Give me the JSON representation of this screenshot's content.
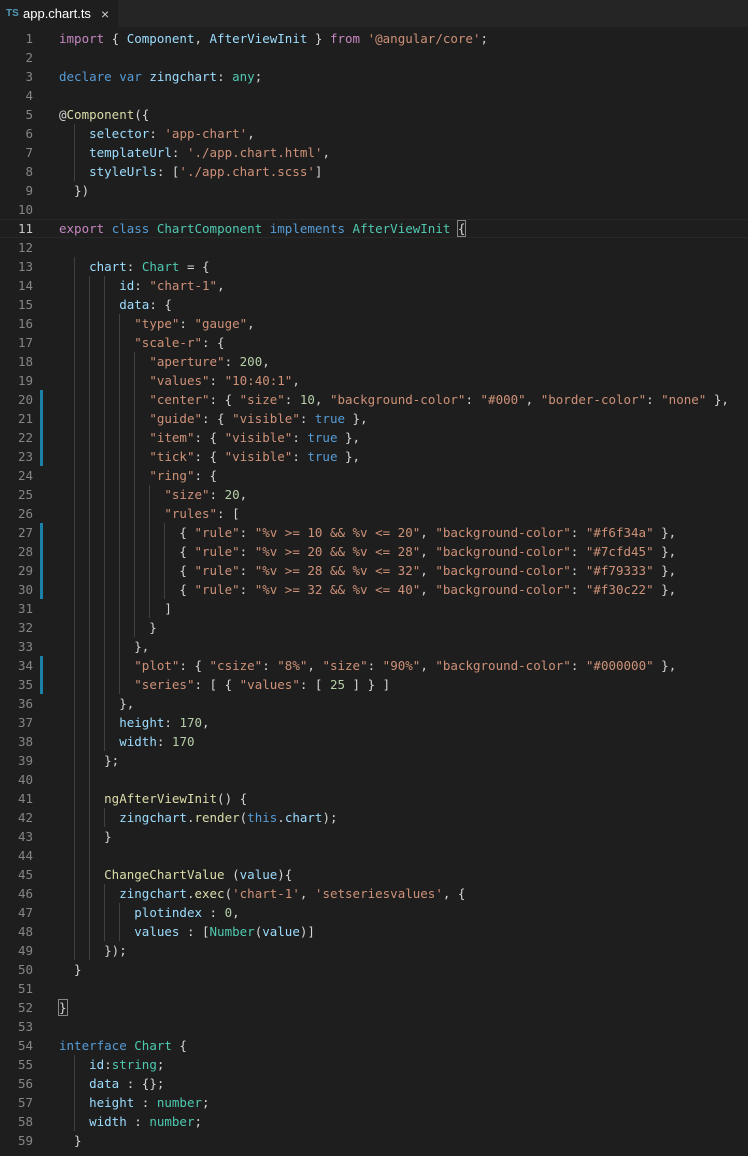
{
  "tab": {
    "icon_text": "TS",
    "filename": "app.chart.ts",
    "close_glyph": "×"
  },
  "editor": {
    "current_line": 11,
    "modified_lines": [
      20,
      21,
      22,
      23,
      27,
      28,
      29,
      30,
      34,
      35
    ],
    "lines": [
      {
        "n": "1",
        "t": [
          [
            "import",
            "ctl"
          ],
          [
            " { "
          ],
          [
            "Component",
            "prop"
          ],
          [
            ", "
          ],
          [
            "AfterViewInit",
            "prop"
          ],
          [
            " } "
          ],
          [
            "from",
            "ctl"
          ],
          [
            " "
          ],
          [
            "'@angular/core'",
            "str"
          ],
          [
            ";"
          ]
        ]
      },
      {
        "n": "2",
        "t": []
      },
      {
        "n": "3",
        "t": [
          [
            "declare",
            "kw"
          ],
          [
            " "
          ],
          [
            "var",
            "kw"
          ],
          [
            " "
          ],
          [
            "zingchart",
            "prop"
          ],
          [
            ": "
          ],
          [
            "any",
            "ty"
          ],
          [
            ";"
          ]
        ]
      },
      {
        "n": "4",
        "t": []
      },
      {
        "n": "5",
        "t": [
          [
            "@"
          ],
          [
            "Component",
            "fn"
          ],
          [
            "({"
          ]
        ]
      },
      {
        "n": "6",
        "t": [
          [
            "    "
          ],
          [
            "selector",
            "prop"
          ],
          [
            ": "
          ],
          [
            "'app-chart'",
            "str"
          ],
          [
            ","
          ]
        ]
      },
      {
        "n": "7",
        "t": [
          [
            "    "
          ],
          [
            "templateUrl",
            "prop"
          ],
          [
            ": "
          ],
          [
            "'./app.chart.html'",
            "str"
          ],
          [
            ","
          ]
        ]
      },
      {
        "n": "8",
        "t": [
          [
            "    "
          ],
          [
            "styleUrls",
            "prop"
          ],
          [
            ": ["
          ],
          [
            "'./app.chart.scss'",
            "str"
          ],
          [
            "]"
          ]
        ]
      },
      {
        "n": "9",
        "t": [
          [
            "  })"
          ]
        ]
      },
      {
        "n": "10",
        "t": []
      },
      {
        "n": "11",
        "t": [
          [
            "export",
            "ctl"
          ],
          [
            " "
          ],
          [
            "class",
            "kw"
          ],
          [
            " "
          ],
          [
            "ChartComponent",
            "ty"
          ],
          [
            " "
          ],
          [
            "implements",
            "kw"
          ],
          [
            " "
          ],
          [
            "AfterViewInit",
            "ty"
          ],
          [
            " "
          ],
          [
            "{",
            "br"
          ]
        ]
      },
      {
        "n": "12",
        "t": []
      },
      {
        "n": "13",
        "t": [
          [
            "    "
          ],
          [
            "chart",
            "prop"
          ],
          [
            ": "
          ],
          [
            "Chart",
            "ty"
          ],
          [
            " = {"
          ]
        ]
      },
      {
        "n": "14",
        "t": [
          [
            "        "
          ],
          [
            "id",
            "prop"
          ],
          [
            ": "
          ],
          [
            "\"chart-1\"",
            "str"
          ],
          [
            ","
          ]
        ]
      },
      {
        "n": "15",
        "t": [
          [
            "        "
          ],
          [
            "data",
            "prop"
          ],
          [
            ": {"
          ]
        ]
      },
      {
        "n": "16",
        "t": [
          [
            "          "
          ],
          [
            "\"type\"",
            "str"
          ],
          [
            ": "
          ],
          [
            "\"gauge\"",
            "str"
          ],
          [
            ","
          ]
        ]
      },
      {
        "n": "17",
        "t": [
          [
            "          "
          ],
          [
            "\"scale-r\"",
            "str"
          ],
          [
            ": {"
          ]
        ]
      },
      {
        "n": "18",
        "t": [
          [
            "            "
          ],
          [
            "\"aperture\"",
            "str"
          ],
          [
            ": "
          ],
          [
            "200",
            "num"
          ],
          [
            ","
          ]
        ]
      },
      {
        "n": "19",
        "t": [
          [
            "            "
          ],
          [
            "\"values\"",
            "str"
          ],
          [
            ": "
          ],
          [
            "\"10:40:1\"",
            "str"
          ],
          [
            ","
          ]
        ]
      },
      {
        "n": "20",
        "t": [
          [
            "            "
          ],
          [
            "\"center\"",
            "str"
          ],
          [
            ": { "
          ],
          [
            "\"size\"",
            "str"
          ],
          [
            ": "
          ],
          [
            "10",
            "num"
          ],
          [
            ", "
          ],
          [
            "\"background-color\"",
            "str"
          ],
          [
            ": "
          ],
          [
            "\"#000\"",
            "str"
          ],
          [
            ", "
          ],
          [
            "\"border-color\"",
            "str"
          ],
          [
            ": "
          ],
          [
            "\"none\"",
            "str"
          ],
          [
            " },"
          ]
        ]
      },
      {
        "n": "21",
        "t": [
          [
            "            "
          ],
          [
            "\"guide\"",
            "str"
          ],
          [
            ": { "
          ],
          [
            "\"visible\"",
            "str"
          ],
          [
            ": "
          ],
          [
            "true",
            "kw"
          ],
          [
            " },"
          ]
        ]
      },
      {
        "n": "22",
        "t": [
          [
            "            "
          ],
          [
            "\"item\"",
            "str"
          ],
          [
            ": { "
          ],
          [
            "\"visible\"",
            "str"
          ],
          [
            ": "
          ],
          [
            "true",
            "kw"
          ],
          [
            " },"
          ]
        ]
      },
      {
        "n": "23",
        "t": [
          [
            "            "
          ],
          [
            "\"tick\"",
            "str"
          ],
          [
            ": { "
          ],
          [
            "\"visible\"",
            "str"
          ],
          [
            ": "
          ],
          [
            "true",
            "kw"
          ],
          [
            " },"
          ]
        ]
      },
      {
        "n": "24",
        "t": [
          [
            "            "
          ],
          [
            "\"ring\"",
            "str"
          ],
          [
            ": {"
          ]
        ]
      },
      {
        "n": "25",
        "t": [
          [
            "              "
          ],
          [
            "\"size\"",
            "str"
          ],
          [
            ": "
          ],
          [
            "20",
            "num"
          ],
          [
            ","
          ]
        ]
      },
      {
        "n": "26",
        "t": [
          [
            "              "
          ],
          [
            "\"rules\"",
            "str"
          ],
          [
            ": ["
          ]
        ]
      },
      {
        "n": "27",
        "t": [
          [
            "                { "
          ],
          [
            "\"rule\"",
            "str"
          ],
          [
            ": "
          ],
          [
            "\"%v >= 10 && %v <= 20\"",
            "str"
          ],
          [
            ", "
          ],
          [
            "\"background-color\"",
            "str"
          ],
          [
            ": "
          ],
          [
            "\"#f6f34a\"",
            "str"
          ],
          [
            " },"
          ]
        ]
      },
      {
        "n": "28",
        "t": [
          [
            "                { "
          ],
          [
            "\"rule\"",
            "str"
          ],
          [
            ": "
          ],
          [
            "\"%v >= 20 && %v <= 28\"",
            "str"
          ],
          [
            ", "
          ],
          [
            "\"background-color\"",
            "str"
          ],
          [
            ": "
          ],
          [
            "\"#7cfd45\"",
            "str"
          ],
          [
            " },"
          ]
        ]
      },
      {
        "n": "29",
        "t": [
          [
            "                { "
          ],
          [
            "\"rule\"",
            "str"
          ],
          [
            ": "
          ],
          [
            "\"%v >= 28 && %v <= 32\"",
            "str"
          ],
          [
            ", "
          ],
          [
            "\"background-color\"",
            "str"
          ],
          [
            ": "
          ],
          [
            "\"#f79333\"",
            "str"
          ],
          [
            " },"
          ]
        ]
      },
      {
        "n": "30",
        "t": [
          [
            "                { "
          ],
          [
            "\"rule\"",
            "str"
          ],
          [
            ": "
          ],
          [
            "\"%v >= 32 && %v <= 40\"",
            "str"
          ],
          [
            ", "
          ],
          [
            "\"background-color\"",
            "str"
          ],
          [
            ": "
          ],
          [
            "\"#f30c22\"",
            "str"
          ],
          [
            " },"
          ]
        ]
      },
      {
        "n": "31",
        "t": [
          [
            "              ]"
          ]
        ]
      },
      {
        "n": "32",
        "t": [
          [
            "            }"
          ]
        ]
      },
      {
        "n": "33",
        "t": [
          [
            "          },"
          ]
        ]
      },
      {
        "n": "34",
        "t": [
          [
            "          "
          ],
          [
            "\"plot\"",
            "str"
          ],
          [
            ": { "
          ],
          [
            "\"csize\"",
            "str"
          ],
          [
            ": "
          ],
          [
            "\"8%\"",
            "str"
          ],
          [
            ", "
          ],
          [
            "\"size\"",
            "str"
          ],
          [
            ": "
          ],
          [
            "\"90%\"",
            "str"
          ],
          [
            ", "
          ],
          [
            "\"background-color\"",
            "str"
          ],
          [
            ": "
          ],
          [
            "\"#000000\"",
            "str"
          ],
          [
            " },"
          ]
        ]
      },
      {
        "n": "35",
        "t": [
          [
            "          "
          ],
          [
            "\"series\"",
            "str"
          ],
          [
            ": [ { "
          ],
          [
            "\"values\"",
            "str"
          ],
          [
            ": [ "
          ],
          [
            "25",
            "num"
          ],
          [
            " ] } ]"
          ]
        ]
      },
      {
        "n": "36",
        "t": [
          [
            "        },"
          ]
        ]
      },
      {
        "n": "37",
        "t": [
          [
            "        "
          ],
          [
            "height",
            "prop"
          ],
          [
            ": "
          ],
          [
            "170",
            "num"
          ],
          [
            ","
          ]
        ]
      },
      {
        "n": "38",
        "t": [
          [
            "        "
          ],
          [
            "width",
            "prop"
          ],
          [
            ": "
          ],
          [
            "170",
            "num"
          ]
        ]
      },
      {
        "n": "39",
        "t": [
          [
            "      };"
          ]
        ]
      },
      {
        "n": "40",
        "t": []
      },
      {
        "n": "41",
        "t": [
          [
            "      "
          ],
          [
            "ngAfterViewInit",
            "fn"
          ],
          [
            "() {"
          ]
        ]
      },
      {
        "n": "42",
        "t": [
          [
            "        "
          ],
          [
            "zingchart",
            "prop"
          ],
          [
            "."
          ],
          [
            "render",
            "fn"
          ],
          [
            "("
          ],
          [
            "this",
            "kw"
          ],
          [
            "."
          ],
          [
            "chart",
            "prop"
          ],
          [
            ");"
          ]
        ]
      },
      {
        "n": "43",
        "t": [
          [
            "      }"
          ]
        ]
      },
      {
        "n": "44",
        "t": []
      },
      {
        "n": "45",
        "t": [
          [
            "      "
          ],
          [
            "ChangeChartValue",
            "fn"
          ],
          [
            " ("
          ],
          [
            "value",
            "prop"
          ],
          [
            "){"
          ]
        ]
      },
      {
        "n": "46",
        "t": [
          [
            "        "
          ],
          [
            "zingchart",
            "prop"
          ],
          [
            "."
          ],
          [
            "exec",
            "fn"
          ],
          [
            "("
          ],
          [
            "'chart-1'",
            "str"
          ],
          [
            ", "
          ],
          [
            "'setseriesvalues'",
            "str"
          ],
          [
            ", {"
          ]
        ]
      },
      {
        "n": "47",
        "t": [
          [
            "          "
          ],
          [
            "plotindex",
            "prop"
          ],
          [
            " : "
          ],
          [
            "0",
            "num"
          ],
          [
            ","
          ]
        ]
      },
      {
        "n": "48",
        "t": [
          [
            "          "
          ],
          [
            "values",
            "prop"
          ],
          [
            " : ["
          ],
          [
            "Number",
            "ty"
          ],
          [
            "("
          ],
          [
            "value",
            "prop"
          ],
          [
            ")]"
          ]
        ]
      },
      {
        "n": "49",
        "t": [
          [
            "      });"
          ]
        ]
      },
      {
        "n": "50",
        "t": [
          [
            "  }"
          ]
        ]
      },
      {
        "n": "51",
        "t": []
      },
      {
        "n": "52",
        "t": [
          [
            "}",
            "br"
          ]
        ]
      },
      {
        "n": "53",
        "t": []
      },
      {
        "n": "54",
        "t": [
          [
            "interface",
            "kw"
          ],
          [
            " "
          ],
          [
            "Chart",
            "ty"
          ],
          [
            " {"
          ]
        ]
      },
      {
        "n": "55",
        "t": [
          [
            "    "
          ],
          [
            "id",
            "prop"
          ],
          [
            ":"
          ],
          [
            "string",
            "ty"
          ],
          [
            ";"
          ]
        ]
      },
      {
        "n": "56",
        "t": [
          [
            "    "
          ],
          [
            "data",
            "prop"
          ],
          [
            " : {};"
          ]
        ]
      },
      {
        "n": "57",
        "t": [
          [
            "    "
          ],
          [
            "height",
            "prop"
          ],
          [
            " : "
          ],
          [
            "number",
            "ty"
          ],
          [
            ";"
          ]
        ]
      },
      {
        "n": "58",
        "t": [
          [
            "    "
          ],
          [
            "width",
            "prop"
          ],
          [
            " : "
          ],
          [
            "number",
            "ty"
          ],
          [
            ";"
          ]
        ]
      },
      {
        "n": "59",
        "t": [
          [
            "  }"
          ]
        ]
      }
    ]
  }
}
